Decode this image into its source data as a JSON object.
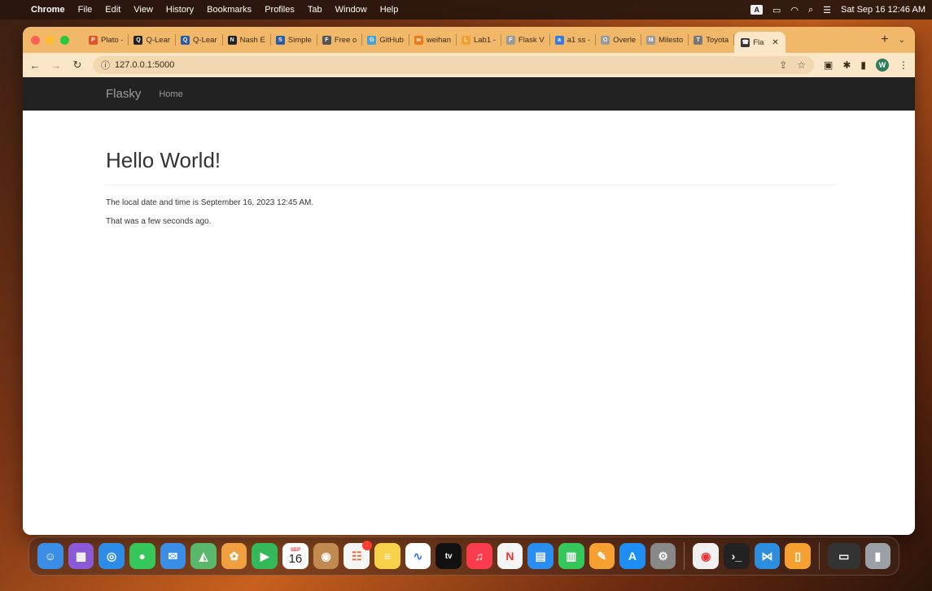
{
  "menubar": {
    "app": "Chrome",
    "items": [
      "File",
      "Edit",
      "View",
      "History",
      "Bookmarks",
      "Profiles",
      "Tab",
      "Window",
      "Help"
    ],
    "input_source": "A",
    "datetime": "Sat Sep 16  12:46 AM"
  },
  "browser": {
    "tabs": [
      {
        "label": "Plato -",
        "fav": "P",
        "color": "#e0542c"
      },
      {
        "label": "Q-Lear",
        "fav": "Q",
        "color": "#222222"
      },
      {
        "label": "Q-Lear",
        "fav": "Q",
        "color": "#2a5aa8"
      },
      {
        "label": "Nash E",
        "fav": "N",
        "color": "#222222"
      },
      {
        "label": "Simple",
        "fav": "S",
        "color": "#2a5aa8"
      },
      {
        "label": "Free o",
        "fav": "F",
        "color": "#555555"
      },
      {
        "label": "GitHub",
        "fav": "G",
        "color": "#4aa0d8"
      },
      {
        "label": "weihan",
        "fav": "w",
        "color": "#f07a1a"
      },
      {
        "label": "Lab1 -",
        "fav": "L",
        "color": "#f0a030"
      },
      {
        "label": "Flask V",
        "fav": "F",
        "color": "#9a9a9a"
      },
      {
        "label": "a1 ss -",
        "fav": "a",
        "color": "#3a7ae0"
      },
      {
        "label": "Overle",
        "fav": "O",
        "color": "#9a9a9a"
      },
      {
        "label": "Milesto",
        "fav": "M",
        "color": "#9a9a9a"
      },
      {
        "label": "Toyota",
        "fav": "T",
        "color": "#777777"
      }
    ],
    "active_tab": "Fla",
    "url": "127.0.0.1:5000"
  },
  "page": {
    "brand": "Flasky",
    "nav_home": "Home",
    "heading": "Hello World!",
    "datetime_line": "The local date and time is September 16, 2023 12:45 AM.",
    "relative_line": "That was a few seconds ago."
  },
  "dock": {
    "calendar_month": "SEP",
    "calendar_day": "16",
    "reminders_badge": "1",
    "tv_label": "tv"
  }
}
